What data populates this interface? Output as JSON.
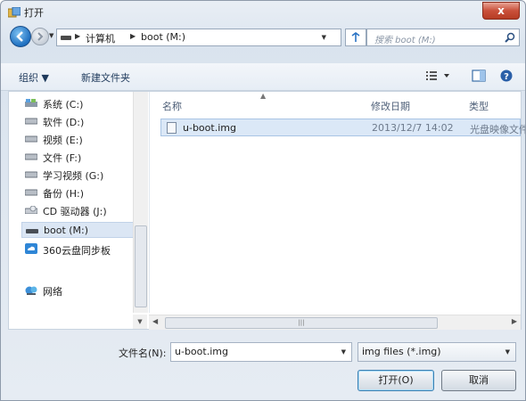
{
  "window": {
    "title": "打开",
    "close_symbol": "x"
  },
  "address_bar": {
    "breadcrumbs": [
      "计算机",
      "boot (M:)"
    ],
    "search_placeholder": "搜索 boot (M:)"
  },
  "toolbar": {
    "organize_label": "组织 ▼",
    "new_folder_label": "新建文件夹"
  },
  "nav_pane": {
    "items": [
      {
        "label": "系统 (C:)",
        "icon": "system-drive-icon"
      },
      {
        "label": "软件 (D:)",
        "icon": "drive-icon"
      },
      {
        "label": "视频 (E:)",
        "icon": "drive-icon"
      },
      {
        "label": "文件 (F:)",
        "icon": "drive-icon"
      },
      {
        "label": "学习视频 (G:)",
        "icon": "drive-icon"
      },
      {
        "label": "备份 (H:)",
        "icon": "drive-icon"
      },
      {
        "label": "CD 驱动器 (J:)",
        "icon": "cd-drive-icon"
      },
      {
        "label": "boot (M:)",
        "icon": "drive-icon",
        "selected": true
      },
      {
        "label": "360云盘同步板",
        "icon": "cloud-icon"
      },
      {
        "label": "网络",
        "icon": "network-icon"
      }
    ]
  },
  "file_list": {
    "columns": [
      "名称",
      "修改日期",
      "类型"
    ],
    "rows": [
      {
        "name": "u-boot.img",
        "modified": "2013/12/7 14:02",
        "type": "光盘映像文件"
      }
    ]
  },
  "footer": {
    "filename_label": "文件名(N):",
    "filename_value": "u-boot.img",
    "filter_value": "img files (*.img)",
    "open_label": "打开(O)",
    "cancel_label": "取消"
  },
  "colors": {
    "accent": "#2a73c4",
    "selection": "#dbe8f7",
    "close_red": "#c9503a"
  }
}
